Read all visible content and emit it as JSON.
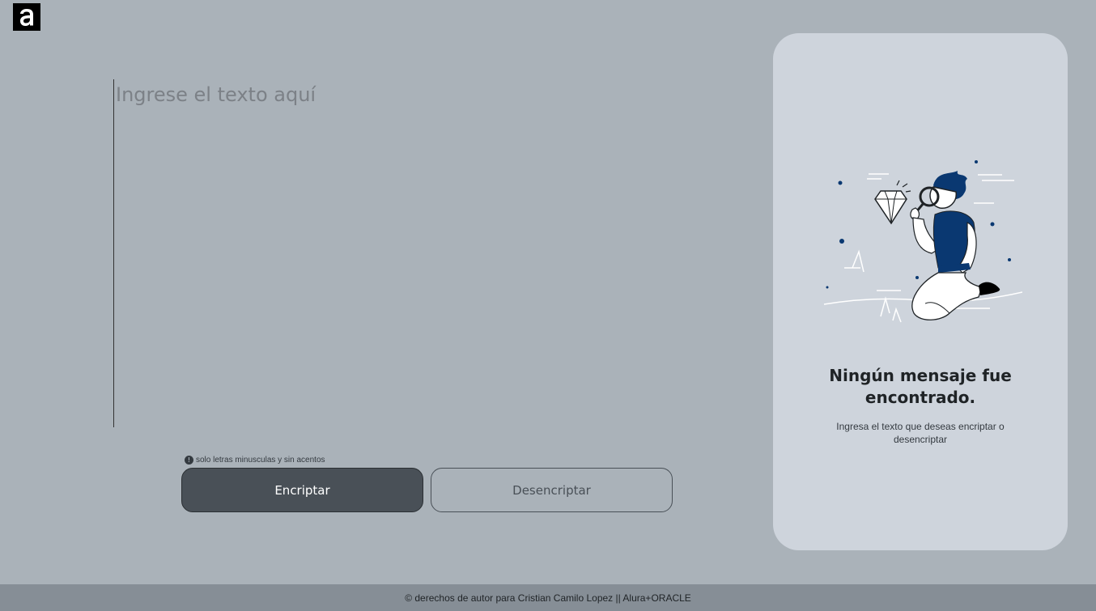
{
  "logo": {
    "letter": "a"
  },
  "input": {
    "placeholder": "Ingrese el texto aquí",
    "value": ""
  },
  "hint": {
    "icon": "!",
    "text": "solo letras minusculas y sin acentos"
  },
  "buttons": {
    "encrypt": "Encriptar",
    "decrypt": "Desencriptar"
  },
  "result_panel": {
    "title": "Ningún mensaje fue encontrado.",
    "subtitle": "Ingresa el texto que deseas encriptar o desencriptar"
  },
  "footer": {
    "text": "© derechos de autor para Cristian Camilo Lopez || Alura+ORACLE"
  },
  "colors": {
    "background": "#aab2b9",
    "panel": "#ced4dc",
    "button_dark": "#495057",
    "footer": "#868e96",
    "accent_blue": "#0a3871"
  }
}
